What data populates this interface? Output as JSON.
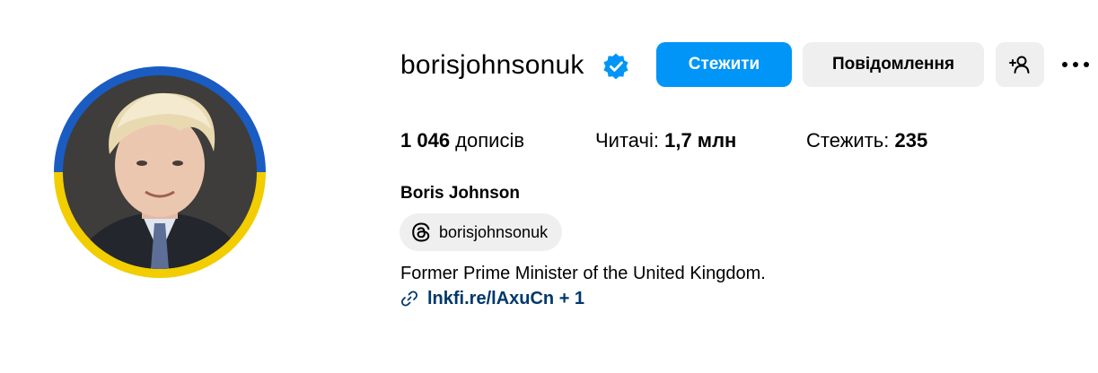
{
  "profile": {
    "username": "borisjohnsonuk",
    "verified_icon": "verified-badge-icon",
    "full_name": "Boris Johnson",
    "threads_handle": "borisjohnsonuk",
    "bio": "Former Prime Minister of the United Kingdom.",
    "link_text": "lnkfi.re/lAxuCn + 1",
    "avatar_ring_colors": [
      "#1a5cc2",
      "#f2cd00"
    ]
  },
  "actions": {
    "follow_label": "Стежити",
    "message_label": "Повідомлення",
    "add_user_icon": "add-user-icon",
    "more_icon": "more-options-icon"
  },
  "stats": {
    "posts_count": "1 046",
    "posts_label": " дописів",
    "followers_label": "Читачі: ",
    "followers_count": "1,7 млн",
    "following_label": "Стежить: ",
    "following_count": "235"
  },
  "colors": {
    "accent": "#0095f6",
    "secondary_button": "#efefef",
    "link": "#00376b",
    "verified": "#0095f6"
  }
}
